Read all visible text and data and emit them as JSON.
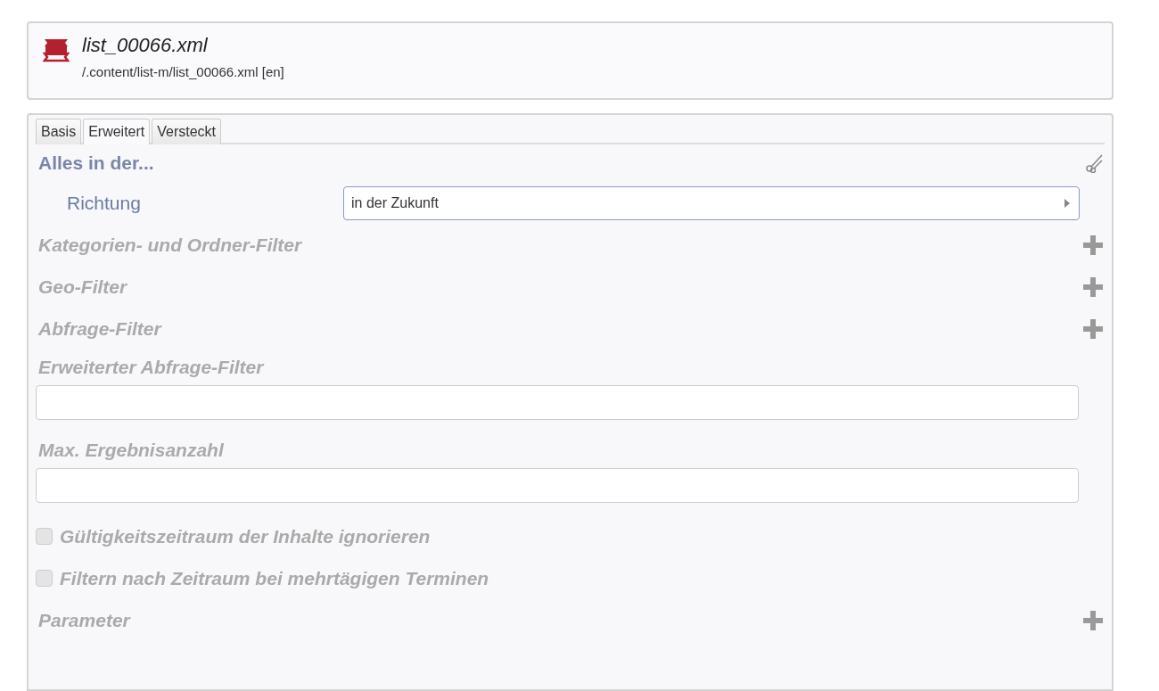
{
  "file": {
    "name": "list_00066.xml",
    "path": "/.content/list-m/list_00066.xml [en]"
  },
  "tabs": [
    {
      "label": "Basis",
      "selected": false
    },
    {
      "label": "Erweitert",
      "selected": true
    },
    {
      "label": "Versteckt",
      "selected": false
    }
  ],
  "section": {
    "title": "Alles in der...",
    "field": {
      "label": "Richtung",
      "value": "in der Zukunft"
    }
  },
  "options": [
    {
      "kind": "addable",
      "label": "Kategorien- und Ordner-Filter"
    },
    {
      "kind": "addable",
      "label": "Geo-Filter"
    },
    {
      "kind": "addable",
      "label": "Abfrage-Filter"
    },
    {
      "kind": "input",
      "label": "Erweiterter Abfrage-Filter"
    },
    {
      "kind": "input",
      "label": "Max. Ergebnisanzahl"
    },
    {
      "kind": "checkbox",
      "label": "Gültigkeitszeitraum der Inhalte ignorieren",
      "checked": false
    },
    {
      "kind": "checkbox",
      "label": "Filtern nach Zeitraum bei mehrtägigen Terminen",
      "checked": false
    },
    {
      "kind": "addable",
      "label": "Parameter"
    }
  ]
}
